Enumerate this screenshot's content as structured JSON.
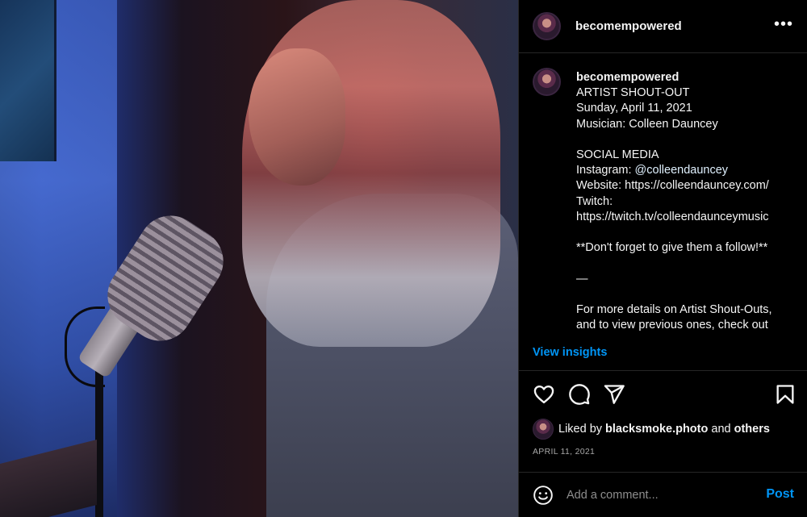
{
  "header": {
    "username": "becomempowered",
    "more_label": "•••"
  },
  "caption": {
    "username": "becomempowered",
    "lines": [
      "ARTIST SHOUT-OUT",
      "Sunday, April 11, 2021",
      "Musician: Colleen Dauncey",
      "",
      "SOCIAL MEDIA",
      "",
      "Website: https://colleendauncey.com/",
      "Twitch:",
      "https://twitch.tv/colleendaunceymusic",
      "",
      "**Don't forget to give them a follow!**",
      "",
      "—",
      "",
      "For more details on Artist Shout-Outs,",
      "and to view previous ones, check out"
    ],
    "instagram_prefix": "Instagram: ",
    "instagram_handle": "@colleendauncey"
  },
  "insights": {
    "label": "View insights"
  },
  "actions": {
    "like_icon": "heart-icon",
    "comment_icon": "comment-icon",
    "share_icon": "share-icon",
    "save_icon": "bookmark-icon"
  },
  "likes": {
    "prefix": "Liked by ",
    "user": "blacksmoke.photo",
    "middle": " and ",
    "others": "others"
  },
  "date": "APRIL 11, 2021",
  "comment": {
    "placeholder": "Add a comment...",
    "post_label": "Post",
    "emoji_icon": "emoji-icon"
  },
  "colors": {
    "accent": "#0095f6",
    "background": "#000000",
    "text": "#f5f5f5",
    "muted": "#a8a8a8"
  }
}
